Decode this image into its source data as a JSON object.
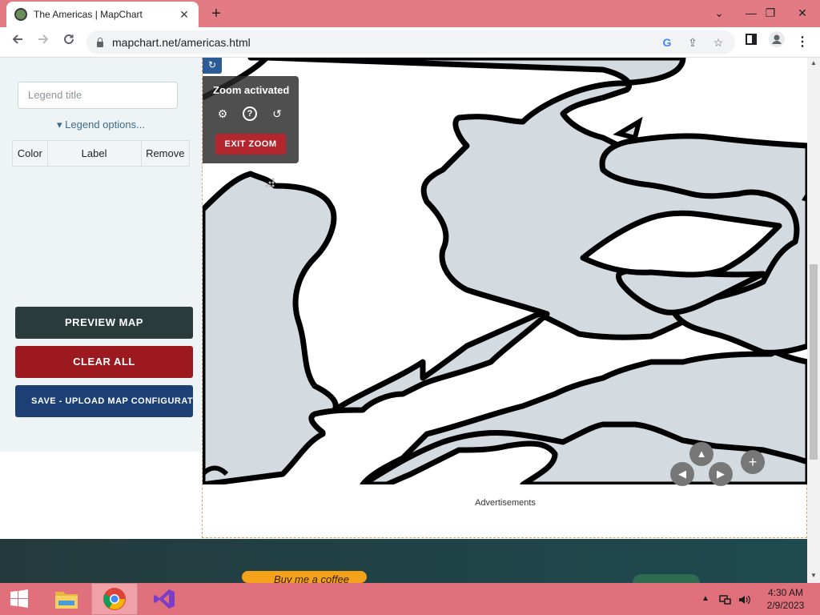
{
  "browser": {
    "tab_title": "The Americas | MapChart",
    "tab_close": "✕",
    "new_tab": "+",
    "url": "mapchart.net/americas.html",
    "window_controls": [
      "⌄",
      "—",
      "❐",
      "✕"
    ]
  },
  "sidebar": {
    "legend_title_placeholder": "Legend title",
    "legend_options": "▾ Legend options...",
    "table_headers": [
      "Color",
      "Label",
      "Remove"
    ],
    "buttons": {
      "preview": "PREVIEW MAP",
      "clear": "CLEAR ALL",
      "save": "SAVE - UPLOAD MAP CONFIGURATION"
    }
  },
  "map": {
    "zoom_status": "Zoom activated",
    "exit_zoom": "EXIT ZOOM",
    "refresh_icon": "↻",
    "settings_icon": "⚙",
    "help_icon": "?",
    "reset_icon": "↺",
    "nav": {
      "up": "▲",
      "left": "◀",
      "right": "▶",
      "zoom_in": "+"
    },
    "land_color": "#d3dbe0",
    "border_color": "#000000"
  },
  "ads": {
    "label": "Advertisements"
  },
  "footer": {
    "coffee_label": "Buy me a coffee"
  },
  "taskbar": {
    "time": "4:30 AM",
    "date": "2/9/2023"
  }
}
